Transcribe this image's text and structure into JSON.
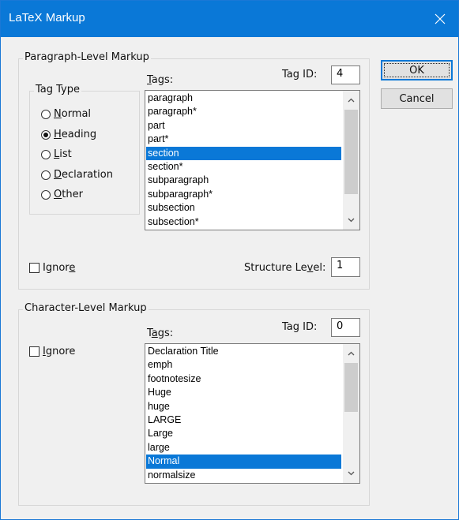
{
  "window": {
    "title": "LaTeX Markup"
  },
  "buttons": {
    "ok": "OK",
    "cancel": "Cancel"
  },
  "paragraph": {
    "group_label": "Paragraph-Level Markup",
    "tag_type_label": "Tag Type",
    "radios": [
      {
        "pre": "",
        "u": "N",
        "post": "ormal",
        "checked": false
      },
      {
        "pre": "",
        "u": "H",
        "post": "eading",
        "checked": true
      },
      {
        "pre": "",
        "u": "L",
        "post": "ist",
        "checked": false
      },
      {
        "pre": "",
        "u": "D",
        "post": "eclaration",
        "checked": false
      },
      {
        "pre": "",
        "u": "O",
        "post": "ther",
        "checked": false
      }
    ],
    "tags_label_u": "T",
    "tags_label_rest": "ags:",
    "tag_id_label": "Tag ID:",
    "tag_id_value": "4",
    "tags": [
      "paragraph",
      "paragraph*",
      "part",
      "part*",
      "section",
      "section*",
      "subparagraph",
      "subparagraph*",
      "subsection",
      "subsection*"
    ],
    "selected_index": 4,
    "ignore_pre": "Ignor",
    "ignore_u": "e",
    "ignore_post": "",
    "structure_level_pre": "Structure Le",
    "structure_level_u": "v",
    "structure_level_post": "el:",
    "structure_level_value": "1"
  },
  "character": {
    "group_label": "Character-Level Markup",
    "tags_label_pre": "T",
    "tags_label_u": "a",
    "tags_label_post": "gs:",
    "tag_id_label": "Tag ID:",
    "tag_id_value": "0",
    "ignore_pre": "",
    "ignore_u": "I",
    "ignore_post": "gnore",
    "tags": [
      "Declaration Title",
      "emph",
      "footnotesize",
      "Huge",
      "huge",
      "LARGE",
      "Large",
      "large",
      "Normal",
      "normalsize"
    ],
    "selected_index": 8
  },
  "icons": {
    "close": "close-icon",
    "scroll_up": "chevron-up-icon",
    "scroll_down": "chevron-down-icon"
  }
}
